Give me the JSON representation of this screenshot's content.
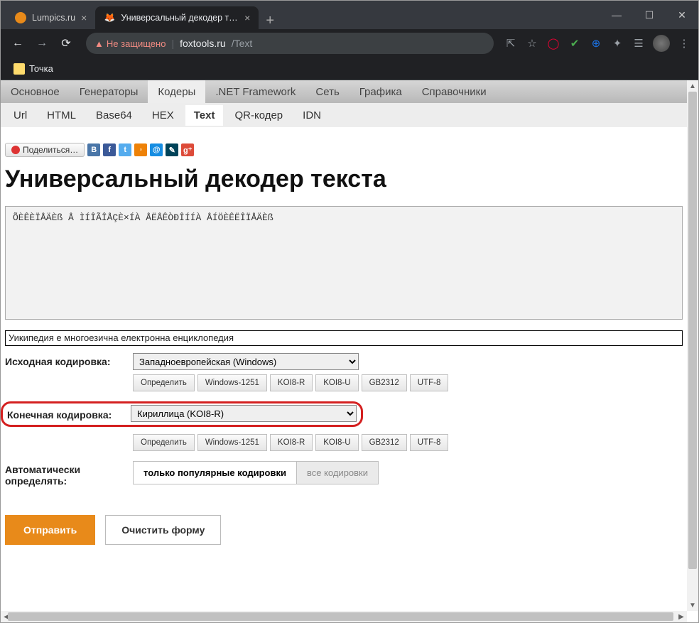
{
  "window": {
    "tabs": [
      {
        "title": "Lumpics.ru",
        "favicon_color": "#e88a1a",
        "active": false
      },
      {
        "title": "Универсальный декодер текста",
        "favicon_color": "#f7a84b",
        "active": true
      }
    ]
  },
  "browser": {
    "security_text": "Не защищено",
    "url_host": "foxtools.ru",
    "url_path": "/Text"
  },
  "bookmarks": [
    {
      "label": "Точка"
    }
  ],
  "sitenav": {
    "items": [
      "Основное",
      "Генераторы",
      "Кодеры",
      ".NET Framework",
      "Сеть",
      "Графика",
      "Справочники"
    ],
    "active_index": 2
  },
  "subnav": {
    "items": [
      "Url",
      "HTML",
      "Base64",
      "HEX",
      "Text",
      "QR-кодер",
      "IDN"
    ],
    "active_index": 4
  },
  "share": {
    "label": "Поделиться…"
  },
  "page_title": "Универсальный декодер текста",
  "input_text": "ÕÈÊÈÏÅÄÈß Å ÌÍÎÃÎÅÇÈ×ÍÀ ÅËÅÊÒÐÎÍÍÀ ÅÍÖÈÊËÎÏÅÄÈß",
  "output_text": "Уикипедия е многоезична електронна енциклопедия",
  "labels": {
    "source_encoding": "Исходная кодировка:",
    "target_encoding": "Конечная кодировка:",
    "auto_detect": "Автоматически определять:"
  },
  "encodings": {
    "source_selected": "Западноевропейская (Windows)",
    "target_selected": "Кириллица (KOI8-R)",
    "quick_buttons": [
      "Определить",
      "Windows-1251",
      "KOI8-R",
      "KOI8-U",
      "GB2312",
      "UTF-8"
    ]
  },
  "auto_detect_options": {
    "popular": "только популярные кодировки",
    "all": "все кодировки"
  },
  "buttons": {
    "submit": "Отправить",
    "clear": "Очистить форму"
  }
}
